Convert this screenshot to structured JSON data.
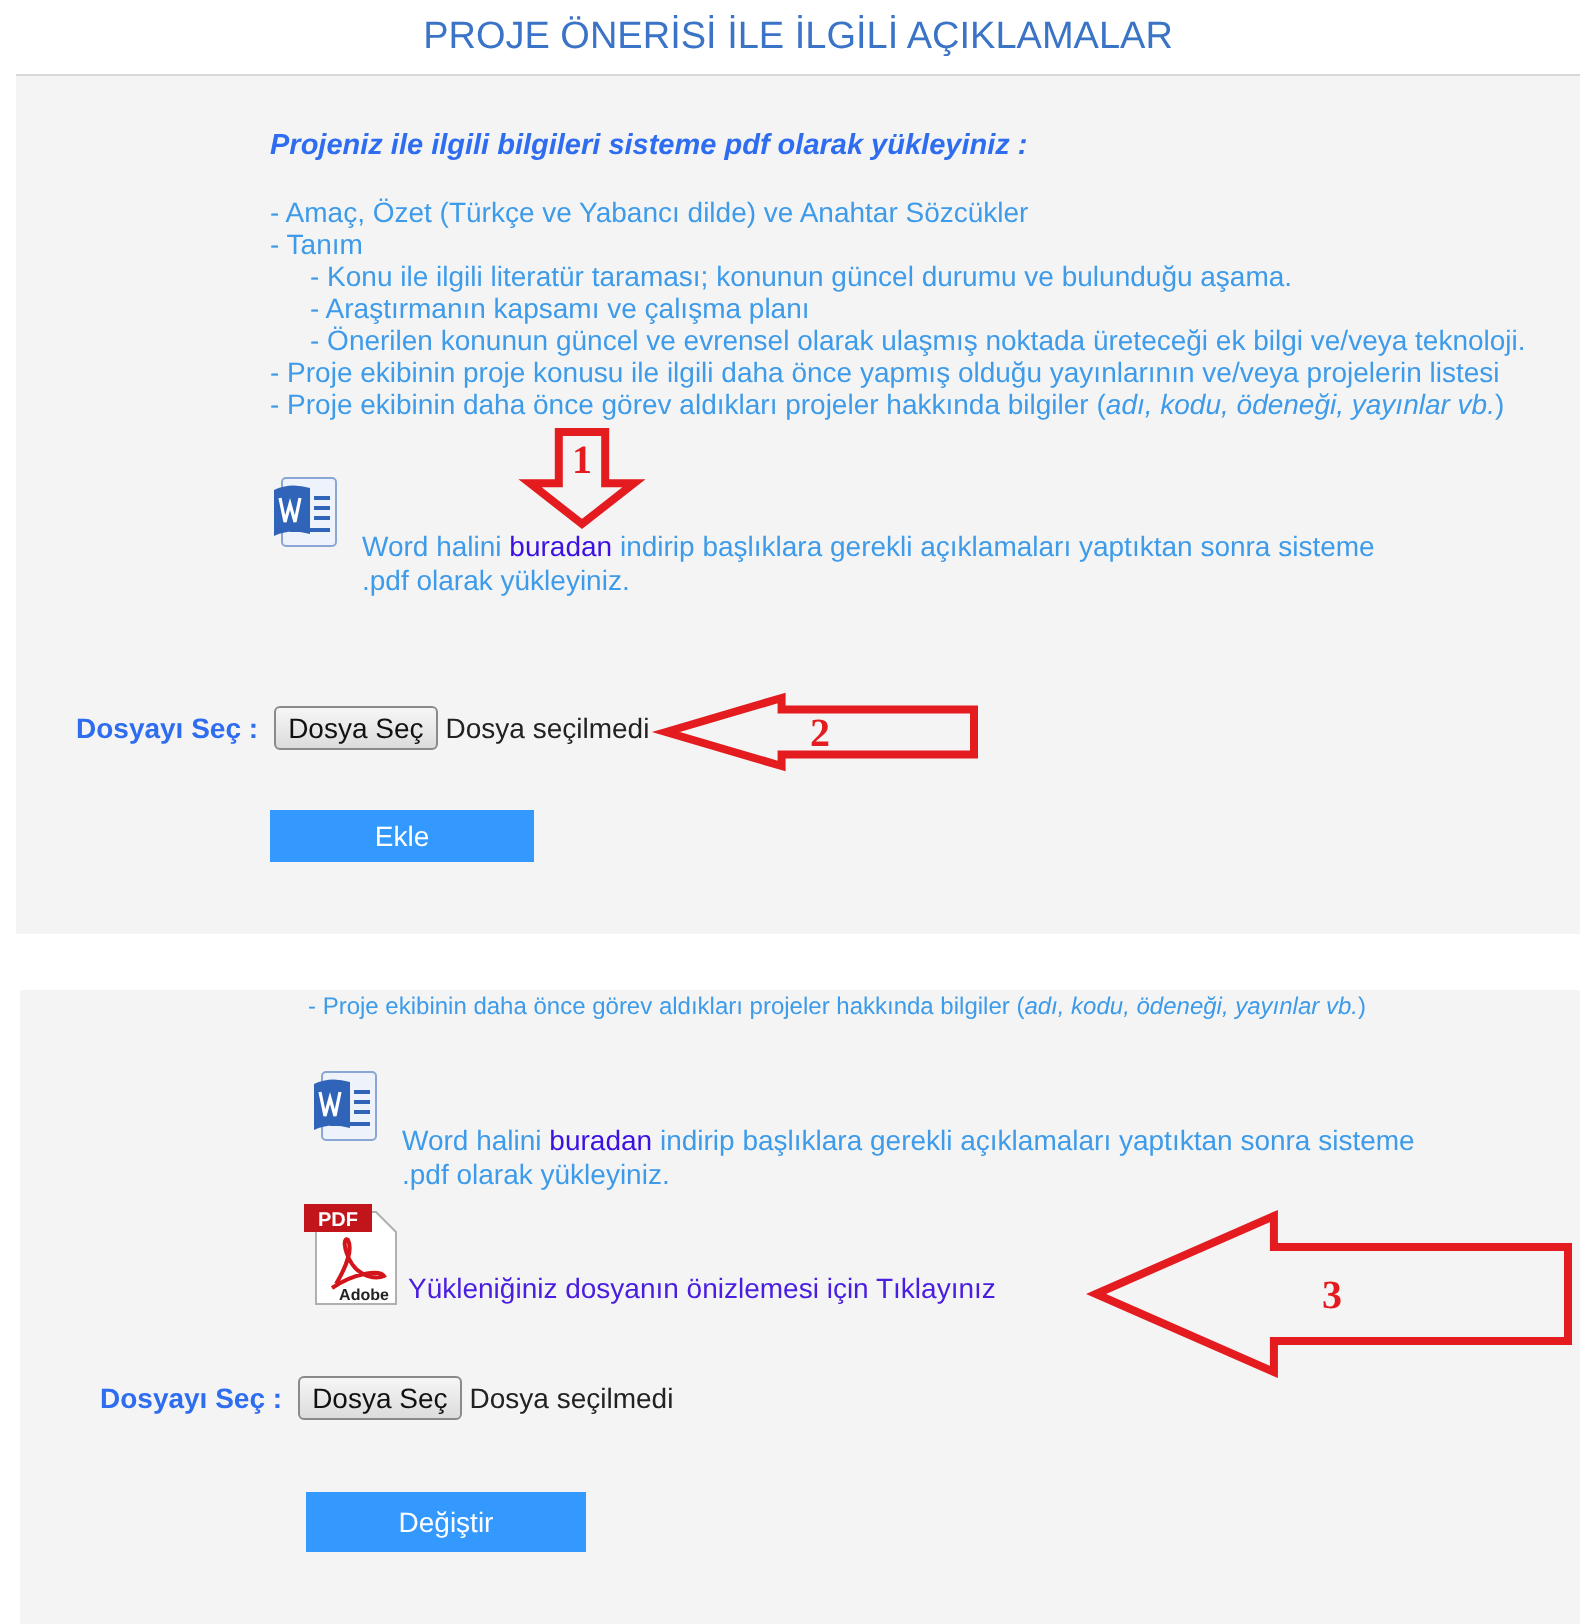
{
  "page_title": "PROJE ÖNERİSİ İLE İLGİLİ AÇIKLAMALAR",
  "upload_panel": {
    "heading": "Projeniz ile ilgili bilgileri sisteme pdf olarak yükleyiniz :",
    "requirements": [
      {
        "text": "- Amaç, Özet (Türkçe ve Yabancı dilde) ve Anahtar Sözcükler"
      },
      {
        "text": "- Tanım",
        "children": [
          {
            "text": "- Konu ile ilgili literatür taraması; konunun güncel durumu ve bulunduğu aşama."
          },
          {
            "text": "- Araştırmanın kapsamı ve çalışma planı"
          },
          {
            "text": "- Önerilen konunun güncel ve evrensel olarak ulaşmış noktada üreteceği ek bilgi ve/veya teknoloji."
          }
        ]
      },
      {
        "text": "- Proje ekibinin proje konusu ile ilgili daha önce yapmış olduğu yayınlarının ve/veya projelerin listesi"
      },
      {
        "text": "- Proje ekibinin daha önce görev aldıkları projeler hakkında bilgiler (*adı, kodu, ödeneği, yayınlar vb.*)"
      }
    ],
    "word_note": {
      "before": "Word halini ",
      "link": "buradan",
      "after": " indirip başlıklara gerekli açıklamaları yaptıktan sonra sisteme .pdf olarak yükleyiniz."
    },
    "file_label": "Dosyayı Seç :",
    "file_button": "Dosya Seç",
    "file_status": "Dosya seçilmedi",
    "submit_button": "Ekle"
  },
  "edit_panel": {
    "cut_line": "- Proje ekibinin daha önce görev aldıkları projeler hakkında bilgiler (*adı, kodu, ödeneği, yayınlar vb.*)",
    "word_note": {
      "before": "Word halini ",
      "link": "buradan",
      "after": " indirip başlıklara gerekli açıklamaları yaptıktan sonra sisteme .pdf olarak yükleyiniz."
    },
    "pdf_icon": {
      "tag": "PDF",
      "brand": "Adobe"
    },
    "preview_link": "Yükleniğiniz dosyanın önizlemesi için Tıklayınız",
    "file_label": "Dosyayı Seç :",
    "file_button": "Dosya Seç",
    "file_status": "Dosya seçilmedi",
    "submit_button": "Değiştir"
  },
  "annotations": [
    {
      "number": "1",
      "kind": "down"
    },
    {
      "number": "2",
      "kind": "left"
    },
    {
      "number": "3",
      "kind": "left"
    }
  ]
}
